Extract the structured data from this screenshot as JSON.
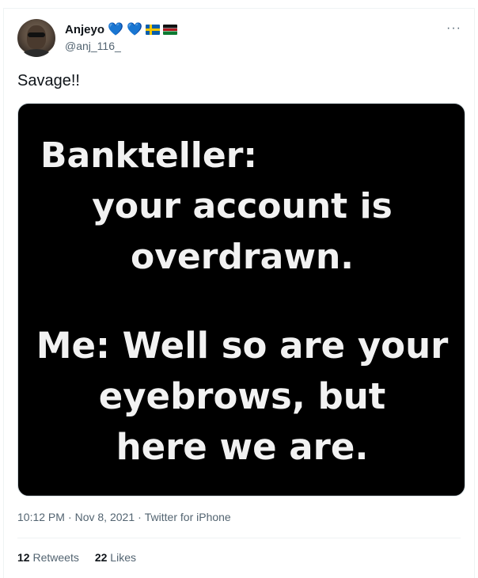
{
  "author": {
    "display_name": "Anjeyo",
    "handle": "@anj_116_",
    "emoji": [
      "💙",
      "💙"
    ],
    "flags": [
      "sweden-flag",
      "kenya-flag"
    ]
  },
  "more_icon": "···",
  "tweet": {
    "text": "Savage!!",
    "image_text": {
      "part_a": [
        "Bankteller:",
        "your account is",
        "overdrawn."
      ],
      "part_b": [
        "Me: Well so are your",
        "eyebrows, but",
        "here we are."
      ]
    }
  },
  "meta": {
    "time": "10:12 PM",
    "sep1": "·",
    "date": "Nov 8, 2021",
    "sep2": "·",
    "source": "Twitter for iPhone"
  },
  "stats": {
    "retweets_count": "12",
    "retweets_label": "Retweets",
    "likes_count": "22",
    "likes_label": "Likes"
  },
  "colors": {
    "text_primary": "#0f1419",
    "text_secondary": "#536471",
    "heart": "#5dade2",
    "media_bg": "#000000"
  }
}
